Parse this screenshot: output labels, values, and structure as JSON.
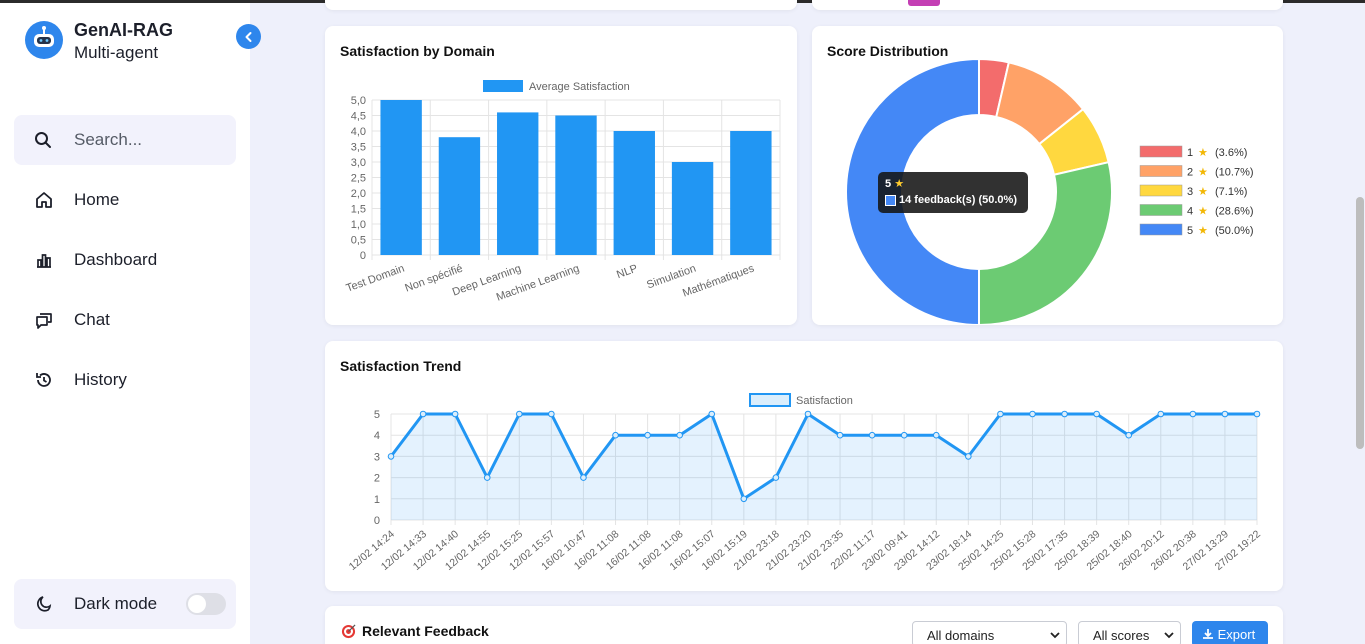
{
  "sidebar": {
    "brand_title": "GenAI-RAG",
    "brand_subtitle": "Multi-agent",
    "search_placeholder": "Search...",
    "items": [
      {
        "label": "Home",
        "icon": "home-icon"
      },
      {
        "label": "Dashboard",
        "icon": "bar-chart-icon"
      },
      {
        "label": "Chat",
        "icon": "chat-icon"
      },
      {
        "label": "History",
        "icon": "history-icon"
      }
    ],
    "dark_mode_label": "Dark mode",
    "dark_mode_on": false
  },
  "cards": {
    "satisfaction_domain_title": "Satisfaction by Domain",
    "score_distribution_title": "Score Distribution",
    "trend_title": "Satisfaction Trend",
    "feedback_title": "Relevant Feedback"
  },
  "filters": {
    "domain_value": "All domains",
    "score_value": "All scores",
    "export_label": "Export"
  },
  "tooltip": {
    "title": "5",
    "body": "14 feedback(s) (50.0%)"
  },
  "colors": {
    "accent": "#2e86ec",
    "bar": "#2196f3"
  },
  "chart_data": [
    {
      "type": "bar",
      "title": "Satisfaction by Domain",
      "legend": "Average Satisfaction",
      "categories": [
        "Test Domain",
        "Non spécifié",
        "Deep Learning",
        "Machine Learning",
        "NLP",
        "Simulation",
        "Mathématiques"
      ],
      "values": [
        5.0,
        3.8,
        4.6,
        4.5,
        4.0,
        3.0,
        4.0
      ],
      "ylim": [
        0,
        5
      ],
      "yticks": [
        "0",
        "0,5",
        "1,0",
        "1,5",
        "2,0",
        "2,5",
        "3,0",
        "3,5",
        "4,0",
        "4,5",
        "5,0"
      ],
      "grid": true,
      "legend_position": "top"
    },
    {
      "type": "pie",
      "title": "Score Distribution",
      "labels": [
        "1",
        "2",
        "3",
        "4",
        "5"
      ],
      "values": [
        3.6,
        10.7,
        7.1,
        28.6,
        50.0
      ],
      "legend_texts": [
        "(3.6%)",
        "(10.7%)",
        "(7.1%)",
        "(28.6%)",
        "(50.0%)"
      ],
      "colors": [
        "#f36c6c",
        "#ffa267",
        "#ffd83f",
        "#6ccb73",
        "#4488f6"
      ],
      "legend_position": "right"
    },
    {
      "type": "area",
      "title": "Satisfaction Trend",
      "legend": "Satisfaction",
      "x": [
        "12/02 14:24",
        "12/02 14:33",
        "12/02 14:40",
        "12/02 14:55",
        "12/02 15:25",
        "12/02 15:57",
        "16/02 10:47",
        "16/02 11:08",
        "16/02 11:08",
        "16/02 11:08",
        "16/02 15:07",
        "16/02 15:19",
        "21/02 23:18",
        "21/02 23:20",
        "21/02 23:35",
        "22/02 11:17",
        "23/02 09:41",
        "23/02 14:12",
        "23/02 18:14",
        "25/02 14:25",
        "25/02 15:28",
        "25/02 17:35",
        "25/02 18:39",
        "25/02 18:40",
        "26/02 20:12",
        "26/02 20:38",
        "27/02 13:29",
        "27/02 19:22"
      ],
      "values": [
        3,
        5,
        5,
        2,
        5,
        5,
        2,
        4,
        4,
        4,
        5,
        1,
        2,
        5,
        4,
        4,
        4,
        4,
        3,
        5,
        5,
        5,
        5,
        4,
        5,
        5,
        5,
        5
      ],
      "ylim": [
        0,
        5
      ],
      "yticks": [
        "0",
        "1",
        "2",
        "3",
        "4",
        "5"
      ],
      "grid": true,
      "legend_position": "top"
    }
  ]
}
